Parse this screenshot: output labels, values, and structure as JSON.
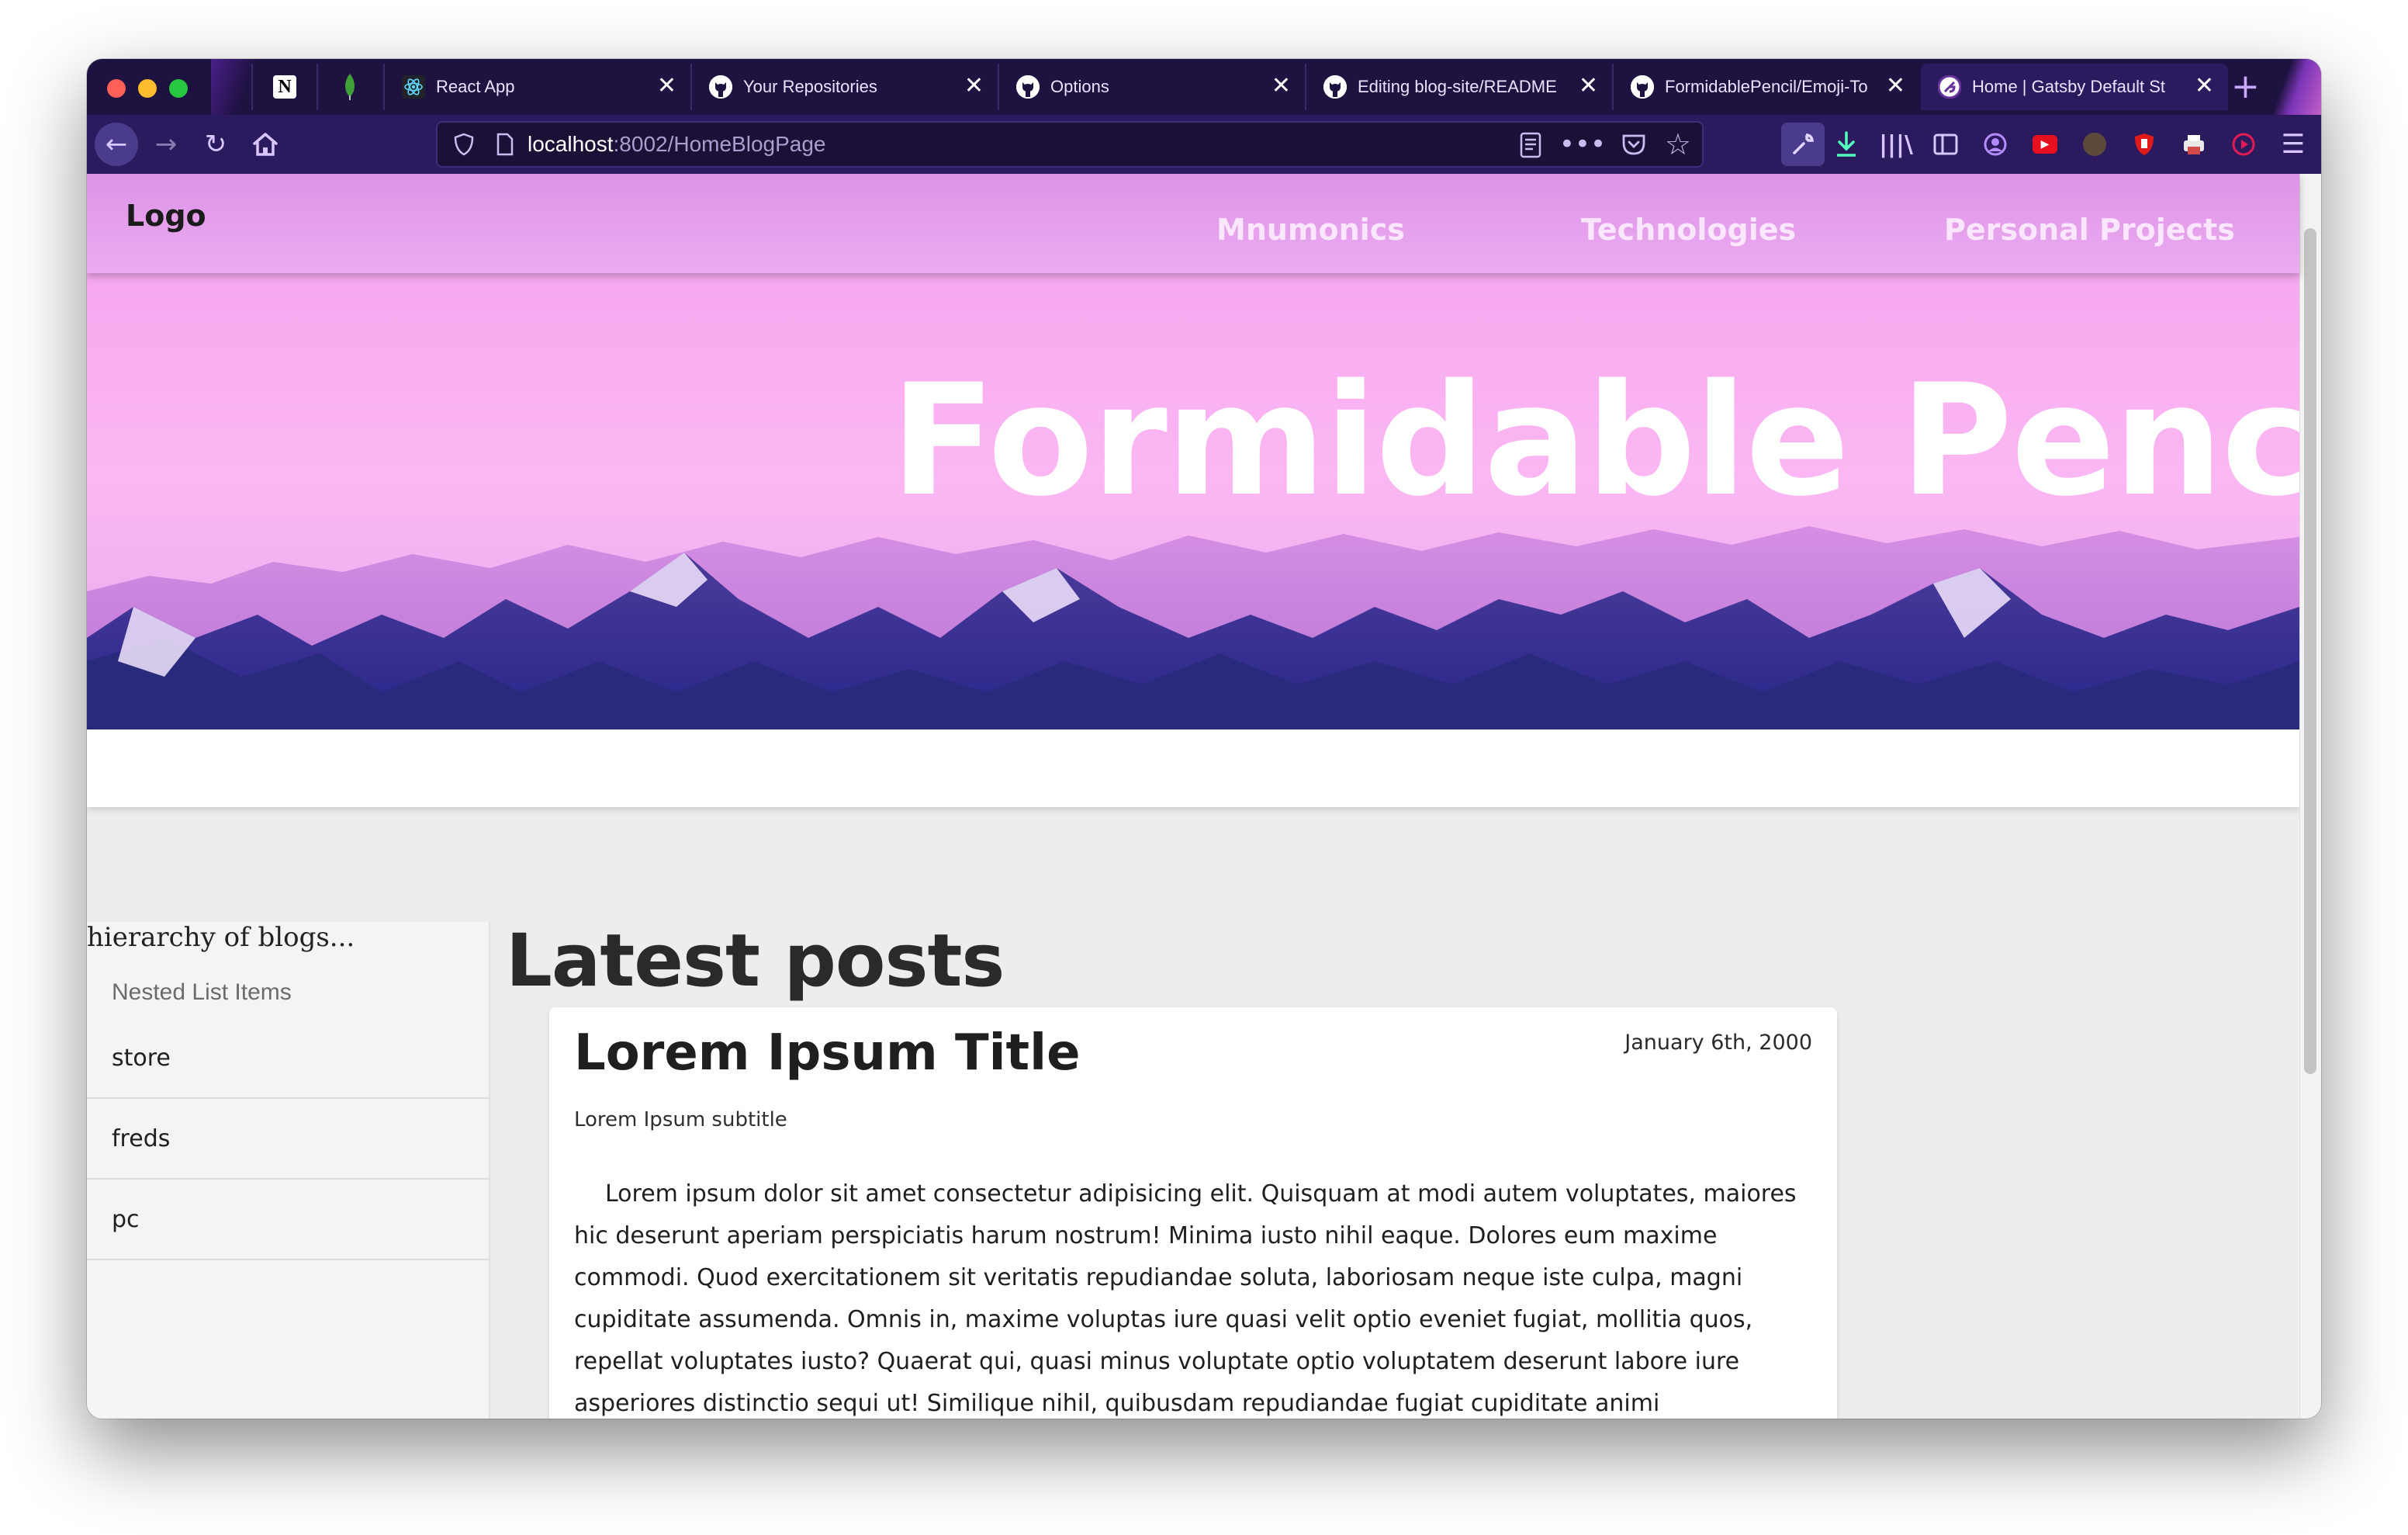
{
  "browser": {
    "tabs": [
      {
        "title": "React App",
        "icon": "react-icon"
      },
      {
        "title": "Your Repositories",
        "icon": "github-icon"
      },
      {
        "title": "Options",
        "icon": "github-icon"
      },
      {
        "title": "Editing blog-site/README",
        "icon": "github-icon"
      },
      {
        "title": "FormidablePencil/Emoji-To",
        "icon": "github-icon"
      },
      {
        "title": "Home | Gatsby Default St",
        "icon": "gatsby-icon",
        "active": true
      }
    ],
    "pinned_tabs": [
      "notion-icon",
      "mongodb-leaf-icon"
    ],
    "url_host": "localhost",
    "url_rest": ":8002/HomeBlogPage",
    "accent_color": "#2b1a5e"
  },
  "header": {
    "logo": "Logo",
    "nav": [
      "Mnumonics",
      "Technologies",
      "Personal Projects"
    ],
    "color": "#e8a6ee"
  },
  "hero": {
    "title": "Formidable Pencil"
  },
  "sidebar": {
    "heading": "hierarchy of blogs...",
    "subheader": "Nested List Items",
    "items": [
      {
        "label": "store"
      },
      {
        "label": "freds"
      },
      {
        "label": "pc"
      }
    ]
  },
  "main": {
    "section_title": "Latest posts",
    "post": {
      "title": "Lorem Ipsum Title",
      "date": "January 6th, 2000",
      "subtitle": "Lorem Ipsum subtitle",
      "body": "Lorem ipsum dolor sit amet consectetur adipisicing elit. Quisquam at modi autem voluptates, maiores hic deserunt aperiam perspiciatis harum nostrum! Minima iusto nihil eaque. Dolores eum maxime commodi. Quod exercitationem sit veritatis repudiandae soluta, laboriosam neque iste culpa, magni cupiditate assumenda. Omnis in, maxime voluptas iure quasi velit optio eveniet fugiat, mollitia quos, repellat voluptates iusto? Quaerat qui, quasi minus voluptate optio voluptatem deserunt labore iure asperiores distinctio sequi ut! Similique nihil, quibusdam repudiandae fugiat cupiditate animi"
    }
  }
}
